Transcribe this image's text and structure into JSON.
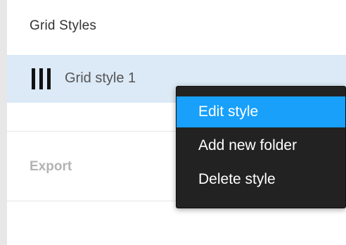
{
  "panel": {
    "section_title": "Grid Styles",
    "export_label": "Export"
  },
  "style_list": {
    "items": [
      {
        "label": "Grid style 1",
        "icon": "grid-columns-icon"
      }
    ]
  },
  "context_menu": {
    "items": [
      {
        "label": "Edit style",
        "active": true
      },
      {
        "label": "Add new folder",
        "active": false
      },
      {
        "label": "Delete style",
        "active": false
      }
    ]
  },
  "colors": {
    "selection_row": "#dce9f6",
    "menu_background": "#222222",
    "menu_highlight": "#18a0fb",
    "muted_text": "#b3b3b3"
  }
}
